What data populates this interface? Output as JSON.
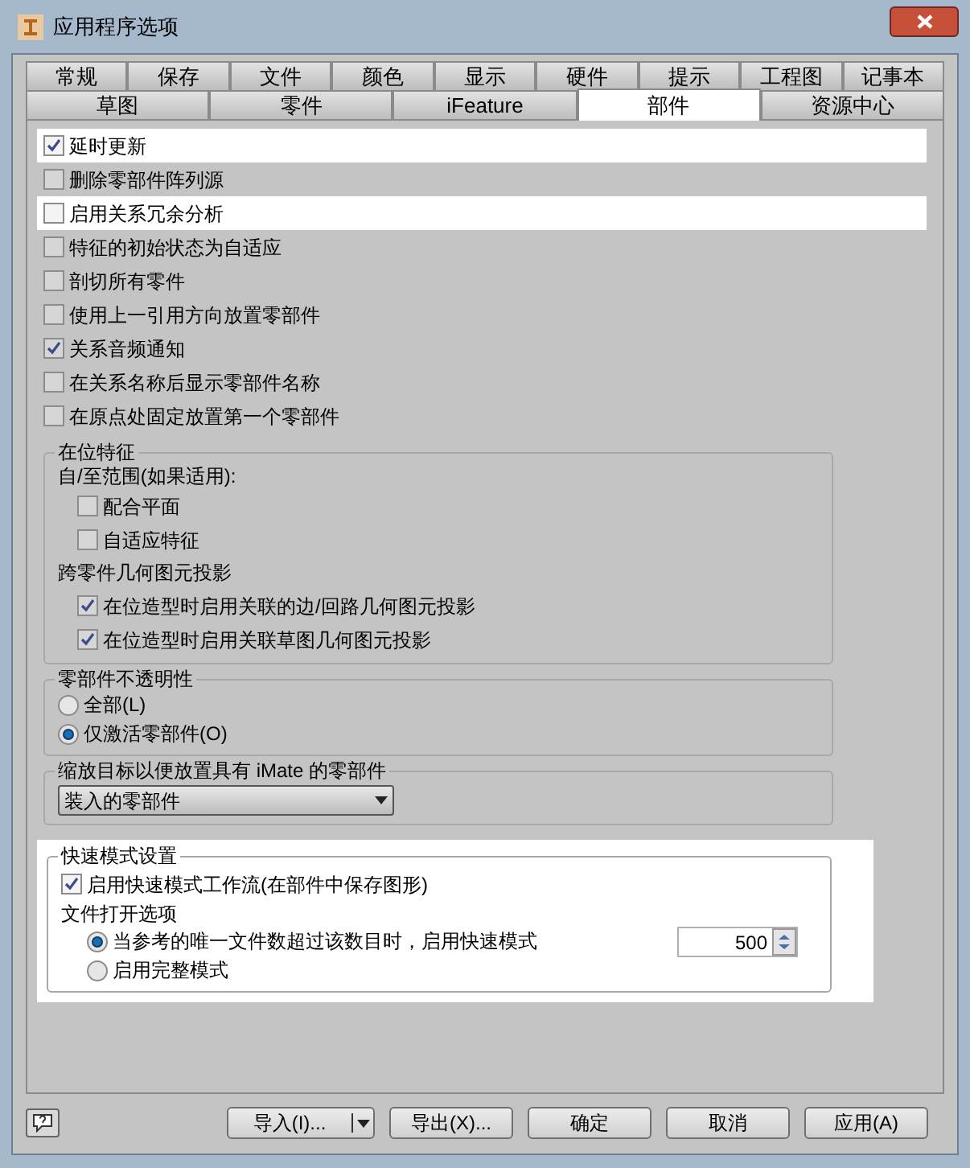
{
  "window": {
    "title": "应用程序选项"
  },
  "tab_rows": [
    [
      {
        "label": "常规",
        "selected": false
      },
      {
        "label": "保存",
        "selected": false
      },
      {
        "label": "文件",
        "selected": false
      },
      {
        "label": "颜色",
        "selected": false
      },
      {
        "label": "显示",
        "selected": false
      },
      {
        "label": "硬件",
        "selected": false
      },
      {
        "label": "提示",
        "selected": false
      },
      {
        "label": "工程图",
        "selected": false
      },
      {
        "label": "记事本",
        "selected": false
      }
    ],
    [
      {
        "label": "草图",
        "selected": false
      },
      {
        "label": "零件",
        "selected": false
      },
      {
        "label": "iFeature",
        "selected": false
      },
      {
        "label": "部件",
        "selected": true
      },
      {
        "label": "资源中心",
        "selected": false
      }
    ]
  ],
  "options": [
    {
      "label": "延时更新",
      "checked": true,
      "highlighted": true
    },
    {
      "label": "删除零部件阵列源",
      "checked": false,
      "highlighted": false
    },
    {
      "label": "启用关系冗余分析",
      "checked": false,
      "highlighted": true
    },
    {
      "label": "特征的初始状态为自适应",
      "checked": false,
      "highlighted": false
    },
    {
      "label": "剖切所有零件",
      "checked": false,
      "highlighted": false
    },
    {
      "label": "使用上一引用方向放置零部件",
      "checked": false,
      "highlighted": false
    },
    {
      "label": "关系音频通知",
      "checked": true,
      "highlighted": false
    },
    {
      "label": "在关系名称后显示零部件名称",
      "checked": false,
      "highlighted": false
    },
    {
      "label": "在原点处固定放置第一个零部件",
      "checked": false,
      "highlighted": false
    }
  ],
  "in_place_features": {
    "title": "在位特征",
    "extent_label": "自/至范围(如果适用):",
    "extent_options": [
      {
        "label": "配合平面",
        "checked": false
      },
      {
        "label": "自适应特征",
        "checked": false
      }
    ],
    "projection_label": "跨零件几何图元投影",
    "projection_options": [
      {
        "label": "在位造型时启用关联的边/回路几何图元投影",
        "checked": true
      },
      {
        "label": "在位造型时启用关联草图几何图元投影",
        "checked": true
      }
    ]
  },
  "opacity": {
    "title": "零部件不透明性",
    "options": [
      {
        "label": "全部(L)",
        "selected": false
      },
      {
        "label": "仅激活零部件(O)",
        "selected": true
      }
    ]
  },
  "zoom_target": {
    "title": "缩放目标以便放置具有 iMate 的零部件",
    "value": "装入的零部件"
  },
  "express_mode": {
    "title": "快速模式设置",
    "highlighted": true,
    "enable": {
      "label": "启用快速模式工作流(在部件中保存图形)",
      "checked": true
    },
    "file_open_label": "文件打开选项",
    "options": [
      {
        "label": "当参考的唯一文件数超过该数目时，启用快速模式",
        "selected": true
      },
      {
        "label": "启用完整模式",
        "selected": false
      }
    ],
    "threshold": "500"
  },
  "buttons": [
    {
      "label": "导入(I)...",
      "kind": "split"
    },
    {
      "label": "导出(X)...",
      "kind": "plain"
    },
    {
      "label": "确定",
      "kind": "plain"
    },
    {
      "label": "取消",
      "kind": "plain"
    },
    {
      "label": "应用(A)",
      "kind": "default"
    }
  ]
}
